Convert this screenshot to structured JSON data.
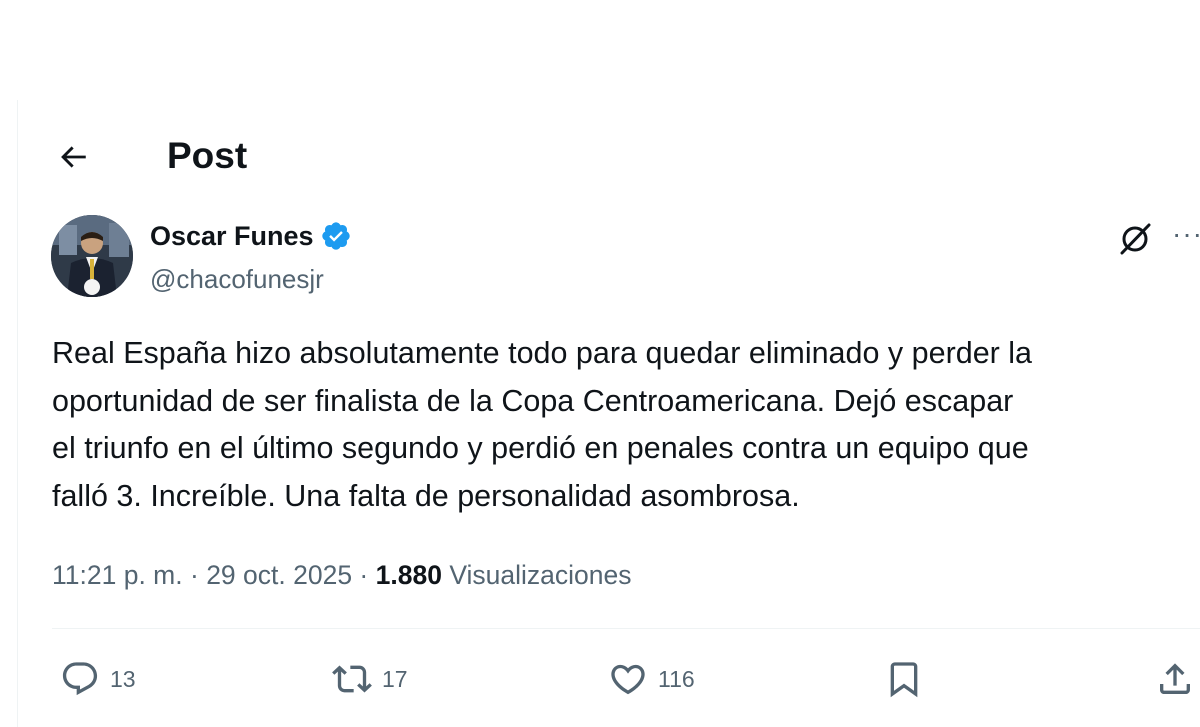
{
  "header": {
    "back_icon": "arrow-left-icon",
    "title": "Post"
  },
  "author": {
    "name": "Oscar Funes",
    "handle": "@chacofunesjr",
    "verified": true,
    "verified_color": "#1d9bf0"
  },
  "tweet": {
    "text": "Real España hizo absolutamente todo para quedar eliminado y perder la\noportunidad de ser finalista de la Copa Centroamericana. Dejó escapar\nel triunfo en el último segundo y perdió en penales contra un equipo que\nfalló 3. Increíble. Una falta de personalidad asombrosa."
  },
  "meta": {
    "time": "11:21 p. m.",
    "separator": " · ",
    "date": "29 oct. 2025",
    "views_count": "1.880",
    "views_label": "Visualizaciones"
  },
  "actions": {
    "replies": "13",
    "reposts": "17",
    "likes": "116"
  },
  "colors": {
    "text_primary": "#0f1419",
    "text_secondary": "#536471",
    "accent": "#1d9bf0",
    "divider": "#eff3f4"
  }
}
